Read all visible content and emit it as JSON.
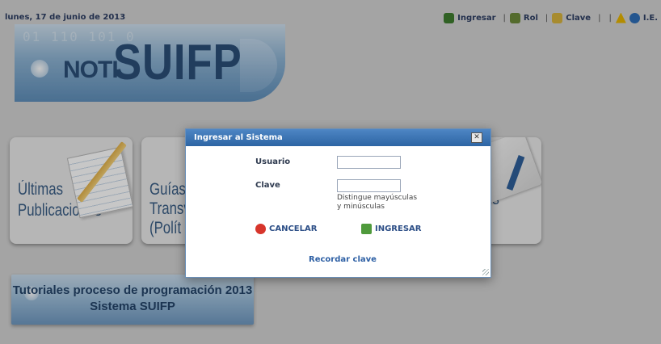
{
  "header": {
    "date": "lunes, 17 de junio de 2013",
    "nav": [
      {
        "label": "Ingresar",
        "icon": "user-icon"
      },
      {
        "label": "Rol",
        "icon": "role-icon"
      },
      {
        "label": "Clave",
        "icon": "key-icon"
      },
      {
        "label": "",
        "icon": ""
      },
      {
        "label": "I.E.",
        "icon": "warning-icon"
      }
    ],
    "separator": "|"
  },
  "banner": {
    "digits": "01 110 101 0",
    "noti": "NOTI",
    "suifp": "SUIFP"
  },
  "tiles": [
    {
      "title_line1": "Últimas",
      "title_line2": "Publicaciones"
    },
    {
      "title_line1": "Guías",
      "title_line2": "Transv",
      "title_line3": "(Polít"
    },
    {
      "title_line1": "os",
      "title_line2": "",
      "title_line3": ""
    }
  ],
  "tutorial": {
    "line1": "Tutoriales proceso de programación 2013",
    "line2": "Sistema SUIFP"
  },
  "dialog": {
    "title": "Ingresar al Sistema",
    "close": "✕",
    "usuario_label": "Usuario",
    "usuario_value": "",
    "clave_label": "Clave",
    "clave_value": "",
    "clave_hint_line1": "Distingue mayúsculas",
    "clave_hint_line2": "y minúsculas",
    "cancel_label": "CANCELAR",
    "login_label": "INGRESAR",
    "remember_label": "Recordar clave"
  },
  "colors": {
    "dialog_title_bar": "#2d65a4",
    "nav_text": "#2d3e63",
    "link": "#2d5fa4"
  }
}
